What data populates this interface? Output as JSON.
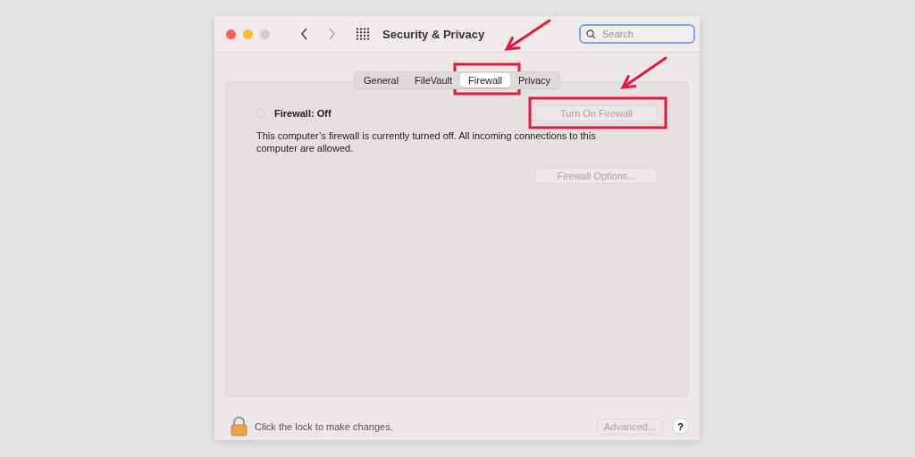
{
  "window": {
    "title": "Security & Privacy",
    "forward_disabled": true
  },
  "search": {
    "placeholder": "Search",
    "focused": true
  },
  "tabs": [
    {
      "label": "General",
      "selected": false
    },
    {
      "label": "FileVault",
      "selected": false
    },
    {
      "label": "Firewall",
      "selected": true
    },
    {
      "label": "Privacy",
      "selected": false
    }
  ],
  "firewall": {
    "status": "Firewall: Off",
    "on": false,
    "description": "This computer’s firewall is currently turned off. All incoming connections to this computer are allowed."
  },
  "buttons": [
    {
      "label": "Turn On Firewall",
      "disabled": true
    },
    {
      "label": "Firewall Options...",
      "disabled": true
    }
  ],
  "footer": {
    "lock_text": "Click the lock to make changes.",
    "advanced": {
      "label": "Advanced...",
      "disabled": true
    },
    "help": "?"
  }
}
